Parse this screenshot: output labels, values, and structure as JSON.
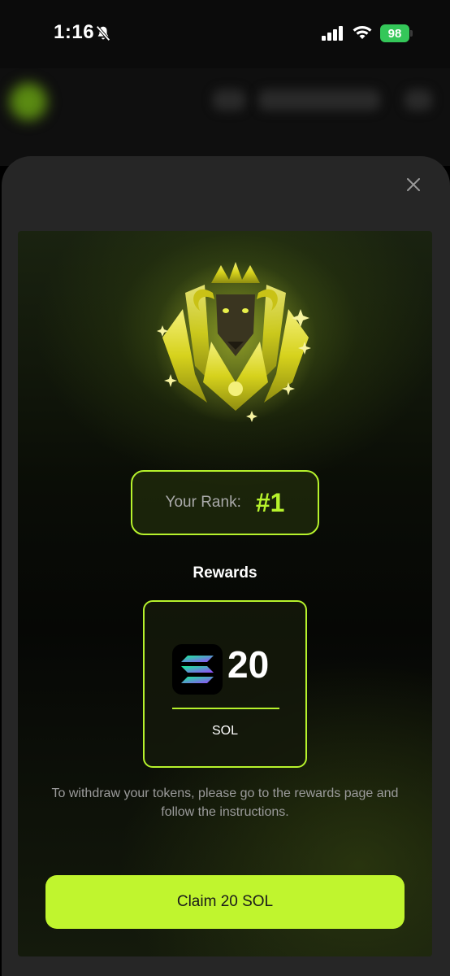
{
  "status_bar": {
    "time": "1:16",
    "battery": "98",
    "icons": [
      "bell-slash-icon",
      "signal-icon",
      "wifi-icon",
      "battery-charging-icon"
    ]
  },
  "modal": {
    "close_icon": "close-icon",
    "badge_icon": "golden-goat-crest-icon",
    "rank_label": "Your Rank:",
    "rank_value": "#1",
    "rewards_title": "Rewards",
    "reward": {
      "token_icon": "solana-logo-icon",
      "amount": "20",
      "token": "SOL"
    },
    "instructions": "To withdraw your tokens, please go to the rewards page and follow the instructions.",
    "claim_label": "Claim 20 SOL"
  },
  "colors": {
    "accent": "#b6f22c",
    "button": "#c0f52e",
    "sheet": "#262626",
    "battery": "#34c759"
  }
}
